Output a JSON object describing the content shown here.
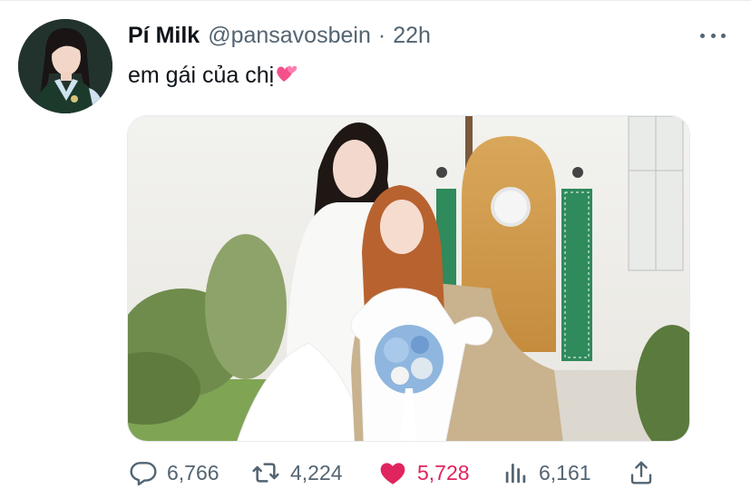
{
  "tweet": {
    "author_name": "Pí Milk",
    "author_handle": "@pansavosbein",
    "separator": "·",
    "time": "22h",
    "text": "em gái của chị",
    "emoji": "💕",
    "avatar_icon": "profile-photo",
    "more_icon": "more-dots-icon",
    "media": {
      "kind": "photo",
      "content": "two women in white dresses posing in front of a house with a wooden arched door"
    }
  },
  "actions": {
    "replies": {
      "icon": "reply-icon",
      "count": "6,766"
    },
    "retweets": {
      "icon": "retweet-icon",
      "count": "4,224"
    },
    "likes": {
      "icon": "heart-filled-icon",
      "count": "5,728",
      "liked": true,
      "color": "#e0245e"
    },
    "views": {
      "icon": "analytics-icon",
      "count": "6,161"
    },
    "share": {
      "icon": "share-icon"
    }
  },
  "colors": {
    "text_primary": "#0f1419",
    "text_secondary": "#536471",
    "like_accent": "#e0245e"
  }
}
